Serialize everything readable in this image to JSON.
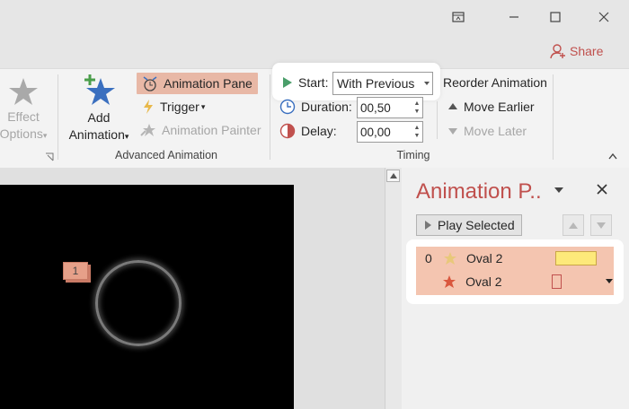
{
  "window": {
    "restore_icon": "ribbon-display-icon",
    "minimize_icon": "minimize-icon",
    "maximize_icon": "maximize-icon",
    "close_icon": "close-icon"
  },
  "share": {
    "label": "Share",
    "icon": "person-add-icon"
  },
  "ribbon": {
    "effect_options": {
      "line1": "Effect",
      "line2": "Options",
      "chevron": "▾"
    },
    "add_animation": {
      "line1": "Add",
      "line2": "Animation",
      "chevron": "▾"
    },
    "animation_pane": "Animation Pane",
    "trigger": "Trigger",
    "trigger_chevron": "▾",
    "animation_painter": "Animation Painter",
    "advanced_group_label": "Advanced Animation",
    "start_label": "Start:",
    "start_value": "With Previous",
    "duration_label": "Duration:",
    "duration_value": "00,50",
    "delay_label": "Delay:",
    "delay_value": "00,00",
    "timing_group_label": "Timing",
    "reorder_title": "Reorder Animation",
    "move_earlier": "Move Earlier",
    "move_later": "Move Later"
  },
  "slide": {
    "marker": "1"
  },
  "pane": {
    "title": "Animation P..",
    "play_selected": "Play Selected",
    "items": [
      {
        "index": "0",
        "name": "Oval 2"
      },
      {
        "index": "",
        "name": "Oval 2"
      }
    ]
  },
  "colors": {
    "accent": "#c0504d",
    "highlight": "#e8b8a6",
    "selection": "#f4c5b0",
    "bar_fill": "#fde97a"
  }
}
